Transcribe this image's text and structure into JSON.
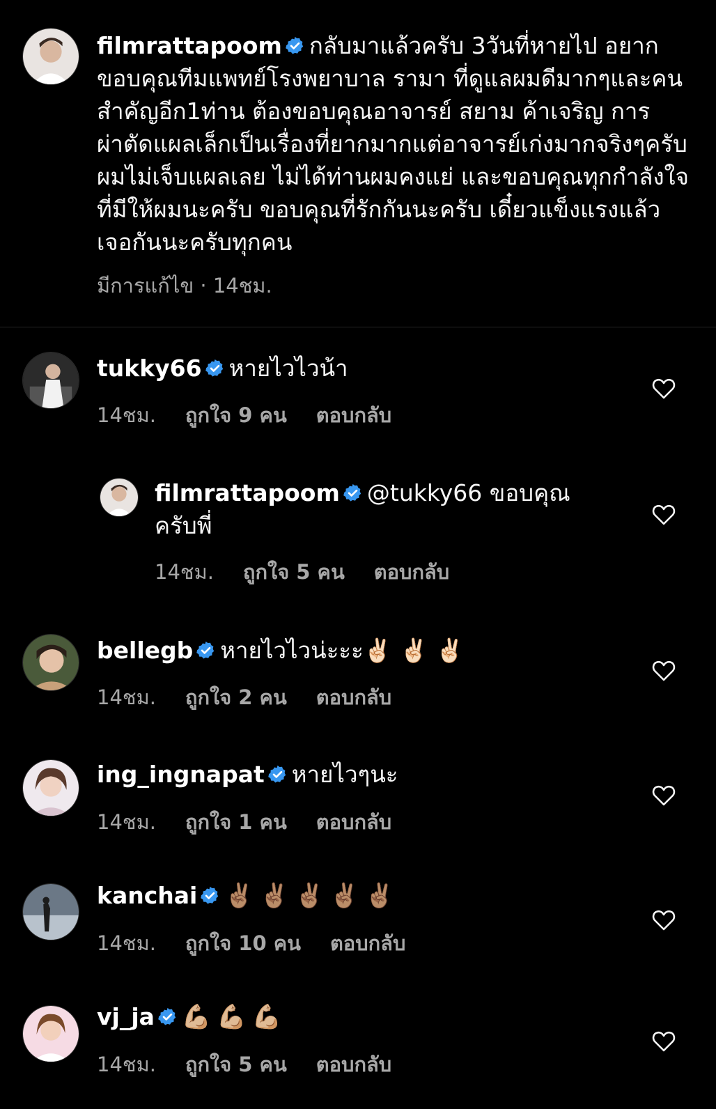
{
  "post": {
    "username": "filmrattapoom",
    "caption": "กลับมาแล้วครับ  3วันที่หายไป อยากขอบคุณทีมแพทย์โรงพยาบาล รามา ที่ดูแลผมดีมากๆและคนสำคัญอีก1ท่าน ต้องขอบคุณอาจารย์ สยาม ค้าเจริญ การผ่าตัดแผลเล็กเป็นเรื่องที่ยากมากแต่อาจารย์เก่งมากจริงๆครับผมไม่เจ็บแผลเลย ไม่ได้ท่านผมคงแย่ และขอบคุณทุกกำลังใจที่มีให้ผมนะครับ ขอบคุณที่รักกันนะครับ เดี๋ยวแข็งแรงแล้วเจอกันนะครับทุกคน",
    "meta": "มีการแก้ไข · 14ชม."
  },
  "reply_label": "ตอบกลับ",
  "comments": [
    {
      "username": "tukky66",
      "text": "หายไวไวน้า",
      "time": "14ชม.",
      "likes": "ถูกใจ 9 คน"
    },
    {
      "username": "filmrattapoom",
      "text": "@tukky66 ขอบคุณครับพี่",
      "time": "14ชม.",
      "likes": "ถูกใจ 5 คน"
    },
    {
      "username": "bellegb",
      "text": "หายไวไวน่ะะะ✌🏻 ✌🏻 ✌🏻",
      "time": "14ชม.",
      "likes": "ถูกใจ 2 คน"
    },
    {
      "username": "ing_ingnapat",
      "text": "หายไวๆนะ",
      "time": "14ชม.",
      "likes": "ถูกใจ 1 คน"
    },
    {
      "username": "kanchai",
      "text": "✌🏽✌🏽✌🏽✌🏽✌🏽",
      "time": "14ชม.",
      "likes": "ถูกใจ 10 คน"
    },
    {
      "username": "vj_ja",
      "text": "💪🏼💪🏼💪🏼",
      "time": "14ชม.",
      "likes": "ถูกใจ 5 คน"
    }
  ],
  "colors": {
    "background": "#000000",
    "secondary_text": "#a8a8a8",
    "verified": "#3897f0",
    "divider": "#262626"
  },
  "icons": {
    "verified": "verified-badge-icon",
    "like": "heart-outline-icon"
  }
}
